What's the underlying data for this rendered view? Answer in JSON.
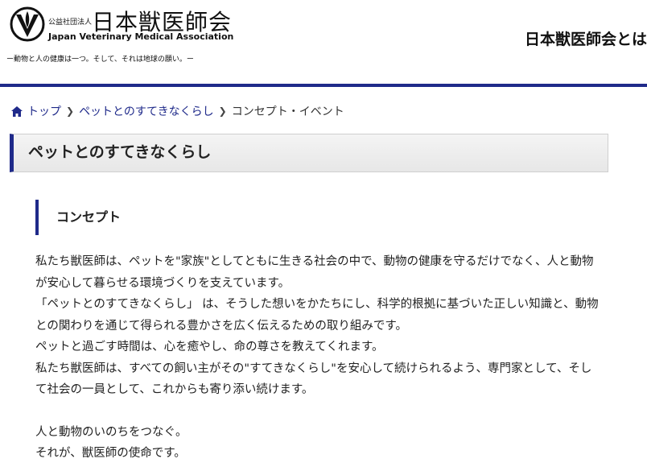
{
  "header": {
    "logo_small": "公益社団法人",
    "logo_big": "日本獣医師会",
    "logo_en": "Japan Veterinary Medical Association",
    "tagline": "ー動物と人の健康は一つ。そして、それは地球の願い。ー",
    "nav_about": "日本獣医師会とは"
  },
  "breadcrumb": {
    "home": "トップ",
    "section": "ペットとのすてきなくらし",
    "current": "コンセプト・イベント"
  },
  "section_title": "ペットとのすてきなくらし",
  "sub_title": "コンセプト",
  "paragraphs": [
    "私たち獣医師は、ペットを\"家族\"としてともに生きる社会の中で、動物の健康を守るだけでなく、人と動物が安心して暮らせる環境づくりを支えています。",
    "「ペットとのすてきなくらし」 は、そうした想いをかたちにし、科学的根拠に基づいた正しい知識と、動物との関わりを通じて得られる豊かさを広く伝えるための取り組みです。",
    "ペットと過ごす時間は、心を癒やし、命の尊さを教えてくれます。",
    "私たち獣医師は、すべての飼い主がその\"すてきなくらし\"を安心して続けられるよう、専門家として、そして社会の一員として、これからも寄り添い続けます。"
  ],
  "closing": [
    "人と動物のいのちをつなぐ。",
    "それが、獣医師の使命です。"
  ],
  "colors": {
    "accent": "#1f2a8a"
  }
}
